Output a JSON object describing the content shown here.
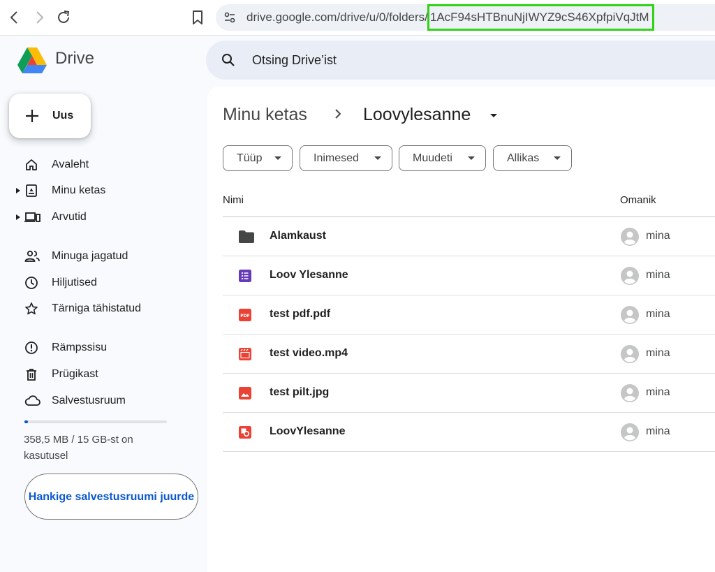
{
  "browser": {
    "url_prefix": "drive.google.com/drive/u/0/folders/",
    "url_highlight": "1AcF94sHTBnuNjIWYZ9cS46XpfpiVqJtM",
    "highlight_color": "#2fd318"
  },
  "app": {
    "brand": "Drive",
    "new_label": "Uus",
    "search_placeholder": "Otsing Drive’ist"
  },
  "sidebar": {
    "items": [
      {
        "label": "Avaleht",
        "icon": "home-icon"
      },
      {
        "label": "Minu ketas",
        "icon": "my-drive-icon"
      },
      {
        "label": "Arvutid",
        "icon": "computers-icon"
      },
      {
        "label": "Minuga jagatud",
        "icon": "shared-icon"
      },
      {
        "label": "Hiljutised",
        "icon": "clock-icon"
      },
      {
        "label": "Tärniga tähistatud",
        "icon": "star-icon"
      },
      {
        "label": "Rämpssisu",
        "icon": "spam-icon"
      },
      {
        "label": "Prügikast",
        "icon": "trash-icon"
      },
      {
        "label": "Salvestusruum",
        "icon": "cloud-icon"
      }
    ],
    "storage": {
      "text": "358,5 MB / 15 GB-st on kasutusel",
      "used_fraction": 0.023,
      "button": "Hankige salvestusruumi juurde"
    }
  },
  "breadcrumb": {
    "root": "Minu ketas",
    "current": "Loovylesanne"
  },
  "filters": [
    "Tüüp",
    "Inimesed",
    "Muudeti",
    "Allikas"
  ],
  "table": {
    "col_name": "Nimi",
    "col_owner": "Omanik",
    "rows": [
      {
        "name": "Alamkaust",
        "type": "folder",
        "owner": "mina"
      },
      {
        "name": "Loov Ylesanne",
        "type": "form",
        "owner": "mina"
      },
      {
        "name": "test pdf.pdf",
        "type": "pdf",
        "owner": "mina"
      },
      {
        "name": "test video.mp4",
        "type": "video",
        "owner": "mina"
      },
      {
        "name": "test pilt.jpg",
        "type": "image",
        "owner": "mina"
      },
      {
        "name": "LoovYlesanne",
        "type": "slides",
        "owner": "mina"
      }
    ]
  },
  "colors": {
    "accent": "#0b57d0",
    "pdf_red": "#ea4335",
    "form_purple": "#673ab7"
  }
}
